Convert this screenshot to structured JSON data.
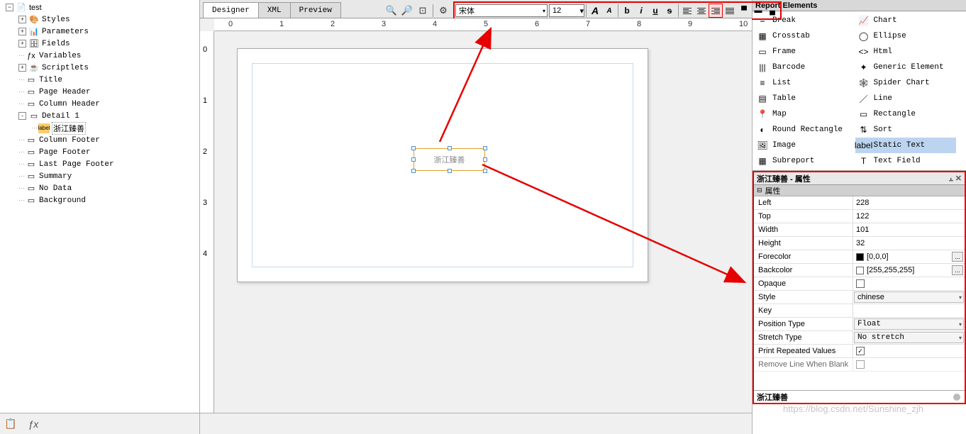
{
  "tree": {
    "root": "test",
    "items": [
      {
        "icon": "🎨",
        "label": "Styles",
        "toggle": "+"
      },
      {
        "icon": "📊",
        "label": "Parameters",
        "toggle": "+"
      },
      {
        "icon": "🗄",
        "label": "Fields",
        "toggle": "+"
      },
      {
        "icon": "ƒx",
        "label": "Variables",
        "toggle": ""
      },
      {
        "icon": "☕",
        "label": "Scriptlets",
        "toggle": "+"
      },
      {
        "icon": "▭",
        "label": "Title",
        "toggle": ""
      },
      {
        "icon": "▭",
        "label": "Page Header",
        "toggle": ""
      },
      {
        "icon": "▭",
        "label": "Column Header",
        "toggle": ""
      },
      {
        "icon": "▭",
        "label": "Detail 1",
        "toggle": "-",
        "children": [
          {
            "icon": "label",
            "label": "浙江臻善",
            "sel": true
          }
        ]
      },
      {
        "icon": "▭",
        "label": "Column Footer",
        "toggle": ""
      },
      {
        "icon": "▭",
        "label": "Page Footer",
        "toggle": ""
      },
      {
        "icon": "▭",
        "label": "Last Page Footer",
        "toggle": ""
      },
      {
        "icon": "▭",
        "label": "Summary",
        "toggle": ""
      },
      {
        "icon": "▭",
        "label": "No Data",
        "toggle": ""
      },
      {
        "icon": "▭",
        "label": "Background",
        "toggle": ""
      }
    ]
  },
  "tabs": {
    "designer": "Designer",
    "xml": "XML",
    "preview": "Preview"
  },
  "toolbar": {
    "font": "宋体",
    "size": "12"
  },
  "ruler_marks": [
    "0",
    "1",
    "2",
    "3",
    "4",
    "5",
    "6",
    "7",
    "8",
    "9",
    "10"
  ],
  "element_text": "浙江臻善",
  "palette": {
    "title": "Report Elements",
    "items": [
      {
        "icon": "⎯",
        "label": "Break"
      },
      {
        "icon": "📈",
        "label": "Chart"
      },
      {
        "icon": "▦",
        "label": "Crosstab"
      },
      {
        "icon": "◯",
        "label": "Ellipse"
      },
      {
        "icon": "▭",
        "label": "Frame"
      },
      {
        "icon": "<>",
        "label": "Html"
      },
      {
        "icon": "|||",
        "label": "Barcode"
      },
      {
        "icon": "✦",
        "label": "Generic Element"
      },
      {
        "icon": "≡",
        "label": "List"
      },
      {
        "icon": "🕸",
        "label": "Spider Chart"
      },
      {
        "icon": "▤",
        "label": "Table"
      },
      {
        "icon": "／",
        "label": "Line"
      },
      {
        "icon": "📍",
        "label": "Map"
      },
      {
        "icon": "▭",
        "label": "Rectangle"
      },
      {
        "icon": "◐",
        "label": "Round Rectangle"
      },
      {
        "icon": "⇅",
        "label": "Sort"
      },
      {
        "icon": "🖼",
        "label": "Image"
      },
      {
        "icon": "label",
        "label": "Static Text",
        "sel": true
      },
      {
        "icon": "▦",
        "label": "Subreport"
      },
      {
        "icon": "T",
        "label": "Text Field"
      }
    ]
  },
  "props": {
    "title": "浙江臻善 - 属性",
    "section": "属性",
    "rows": [
      {
        "name": "Left",
        "val": "228"
      },
      {
        "name": "Top",
        "val": "122"
      },
      {
        "name": "Width",
        "val": "101"
      },
      {
        "name": "Height",
        "val": "32"
      },
      {
        "name": "Forecolor",
        "val": "[0,0,0]",
        "swatch": "#000",
        "dots": true
      },
      {
        "name": "Backcolor",
        "val": "[255,255,255]",
        "swatch": "#fff",
        "dots": true
      },
      {
        "name": "Opaque",
        "chk": false
      },
      {
        "name": "Style",
        "val": "chinese",
        "dd": true
      },
      {
        "name": "Key",
        "val": ""
      },
      {
        "name": "Position Type",
        "val": "Float",
        "dd": true,
        "mono": true
      },
      {
        "name": "Stretch Type",
        "val": "No stretch",
        "dd": true,
        "mono": true
      },
      {
        "name": "Print Repeated Values",
        "chk": true
      },
      {
        "name": "Remove Line When Blank",
        "chk": false,
        "cut": true
      }
    ],
    "footer": "浙江臻善"
  },
  "watermark": "https://blog.csdn.net/Sunshine_zjh"
}
